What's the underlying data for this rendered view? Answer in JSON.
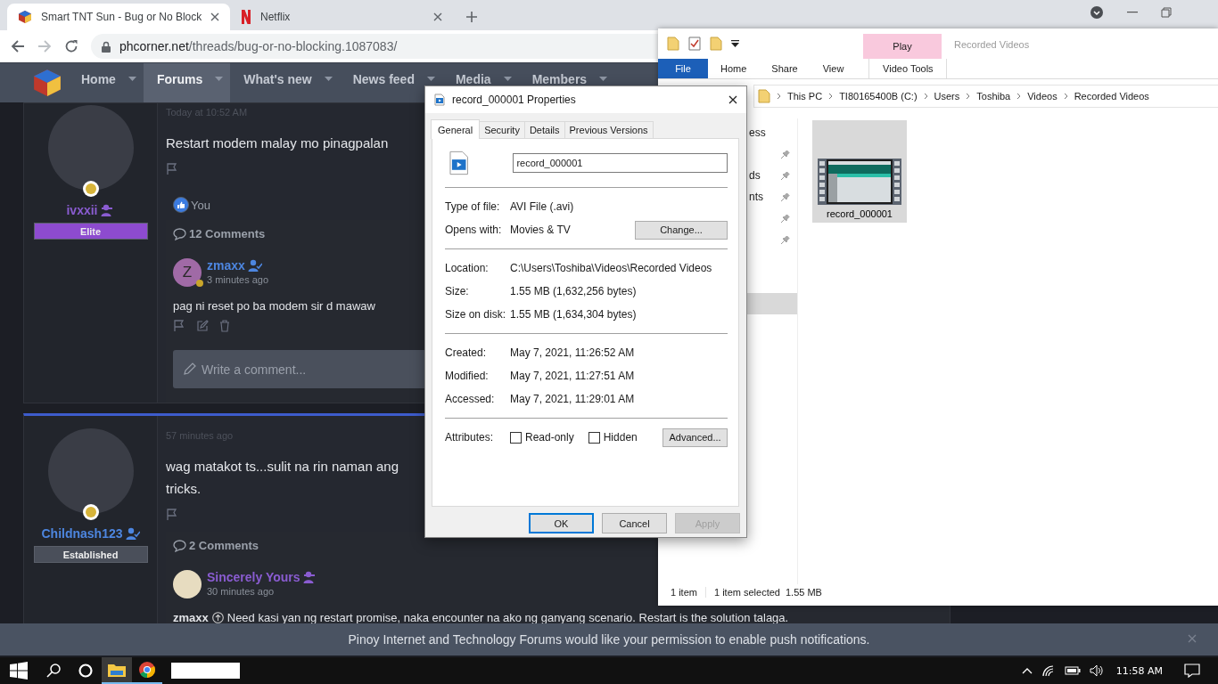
{
  "browser": {
    "tabs": [
      {
        "title": "Smart TNT Sun - Bug or No Block",
        "selected": true
      },
      {
        "title": "Netflix",
        "selected": false
      }
    ],
    "address": {
      "host": "phcorner.net",
      "path": "/threads/bug-or-no-blocking.1087083/"
    },
    "site_nav": [
      {
        "label": "Home",
        "selected": false
      },
      {
        "label": "Forums",
        "selected": true
      },
      {
        "label": "What's new",
        "selected": false
      },
      {
        "label": "News feed",
        "selected": false
      },
      {
        "label": "Media",
        "selected": false
      },
      {
        "label": "Members",
        "selected": false
      }
    ],
    "posts": [
      {
        "highlighted": false,
        "time": "Today at 10:52 AM",
        "author": {
          "name": "ivxxii",
          "color": "#8a5cd1",
          "badge": {
            "kind": "incognito"
          }
        },
        "rank": {
          "label": "Elite",
          "color": "#8d4bcf"
        },
        "body": [
          "Restart modem malay mo pinagpalan"
        ],
        "reaction": "You",
        "comment_count": "12 Comments",
        "comments": [
          {
            "author": {
              "name": "zmaxx",
              "color": "#4d86e0",
              "badge": {
                "kind": "verified"
              }
            },
            "avatar": {
              "kind": "letter",
              "letter": "Z"
            },
            "time": "3 minutes ago",
            "text": "pag ni reset po ba modem sir d mawaw",
            "actions": true
          }
        ],
        "comment_placeholder": "Write a comment..."
      },
      {
        "highlighted": true,
        "time": "57 minutes ago",
        "author": {
          "name": "Childnash123",
          "color": "#4d86e0",
          "badge": {
            "kind": "verified"
          }
        },
        "rank": {
          "label": "Established",
          "color": "#4a4f5a"
        },
        "body": [
          "wag matakot ts...sulit na rin naman ang",
          "tricks."
        ],
        "comment_count": "2 Comments",
        "comments": [
          {
            "author": {
              "name": "Sincerely Yours",
              "color": "#8a5cd1",
              "badge": {
                "kind": "incognito"
              }
            },
            "avatar": {
              "kind": "photo"
            },
            "time": "30 minutes ago",
            "mention": "zmaxx",
            "text": "Need kasi yan ng restart promise, naka encounter na ako ng ganyang scenario. Restart is the solution talaga.",
            "actions": false
          }
        ]
      }
    ],
    "notification": "Pinoy Internet and Technology Forums would like your permission to enable push notifications."
  },
  "explorer": {
    "title": "Recorded Videos",
    "context_group": "Play",
    "ribbon_tabs": [
      {
        "label": "File",
        "kind": "file"
      },
      {
        "label": "Home",
        "kind": "tab"
      },
      {
        "label": "Share",
        "kind": "tab"
      },
      {
        "label": "View",
        "kind": "tab"
      },
      {
        "label": "Video Tools",
        "kind": "context"
      }
    ],
    "breadcrumb": [
      "This PC",
      "TI80165400B (C:)",
      "Users",
      "Toshiba",
      "Videos",
      "Recorded Videos"
    ],
    "nav_items": [
      {
        "label": "ess",
        "pinned": false,
        "selected": false
      },
      {
        "pinned": true,
        "selected": false
      },
      {
        "label": "ds",
        "pinned": true,
        "selected": false
      },
      {
        "label": "nts",
        "pinned": true,
        "selected": false
      },
      {
        "pinned": true,
        "selected": false
      },
      {
        "pinned": true,
        "selected": false
      },
      {
        "pinned": false,
        "selected": false
      },
      {
        "pinned": false,
        "selected": false
      },
      {
        "pinned": false,
        "selected": true
      }
    ],
    "files": [
      {
        "name": "record_000001",
        "selected": true
      }
    ],
    "status": {
      "count": "1 item",
      "selection": "1 item selected",
      "size": "1.55 MB"
    }
  },
  "dialog": {
    "title": "record_000001 Properties",
    "tabs": [
      {
        "label": "General",
        "selected": true
      },
      {
        "label": "Security",
        "selected": false
      },
      {
        "label": "Details",
        "selected": false
      },
      {
        "label": "Previous Versions",
        "selected": false
      }
    ],
    "file_name": "record_000001",
    "sections": [
      [
        {
          "label": "Type of file:",
          "value": "AVI File (.avi)"
        },
        {
          "label": "Opens with:",
          "value": "Movies & TV",
          "button": "Change..."
        }
      ],
      [
        {
          "label": "Location:",
          "value": "C:\\Users\\Toshiba\\Videos\\Recorded Videos"
        },
        {
          "label": "Size:",
          "value": "1.55 MB (1,632,256 bytes)"
        },
        {
          "label": "Size on disk:",
          "value": "1.55 MB (1,634,304 bytes)"
        }
      ],
      [
        {
          "label": "Created:",
          "value": "May 7, 2021, 11:26:52 AM"
        },
        {
          "label": "Modified:",
          "value": "May 7, 2021, 11:27:51 AM"
        },
        {
          "label": "Accessed:",
          "value": "May 7, 2021, 11:29:01 AM"
        }
      ]
    ],
    "attributes": {
      "label": "Attributes:",
      "checkboxes": [
        {
          "label": "Read-only",
          "checked": false
        },
        {
          "label": "Hidden",
          "checked": false
        }
      ],
      "button": "Advanced..."
    },
    "buttons": [
      {
        "label": "OK",
        "default": true,
        "disabled": false
      },
      {
        "label": "Cancel",
        "default": false,
        "disabled": false
      },
      {
        "label": "Apply",
        "default": false,
        "disabled": true
      }
    ]
  },
  "taskbar": {
    "apps": [
      {
        "kind": "explorer",
        "active": true
      },
      {
        "kind": "chrome",
        "active": false
      }
    ],
    "clock": "11:58 AM"
  }
}
